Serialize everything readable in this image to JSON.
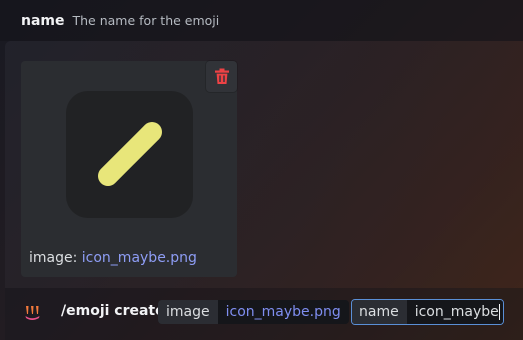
{
  "option_hint": {
    "name": "name",
    "description": "The name for the emoji"
  },
  "attachment": {
    "caption_prefix": "image: ",
    "filename": "icon_maybe.png",
    "preview_icon": "diagonal-pill-icon",
    "delete_icon": "trash-icon"
  },
  "command": {
    "app_icon": "bot-app-icon",
    "name": "/emoji create",
    "options": [
      {
        "label": "image",
        "value": "icon_maybe.png"
      },
      {
        "label": "name",
        "value": "icon_maybe"
      }
    ]
  },
  "colors": {
    "delete_red": "#ed4245",
    "pill_yellow": "#e8e67a",
    "link_blue": "#8e9df5",
    "focus_border": "#5a8fd6"
  }
}
